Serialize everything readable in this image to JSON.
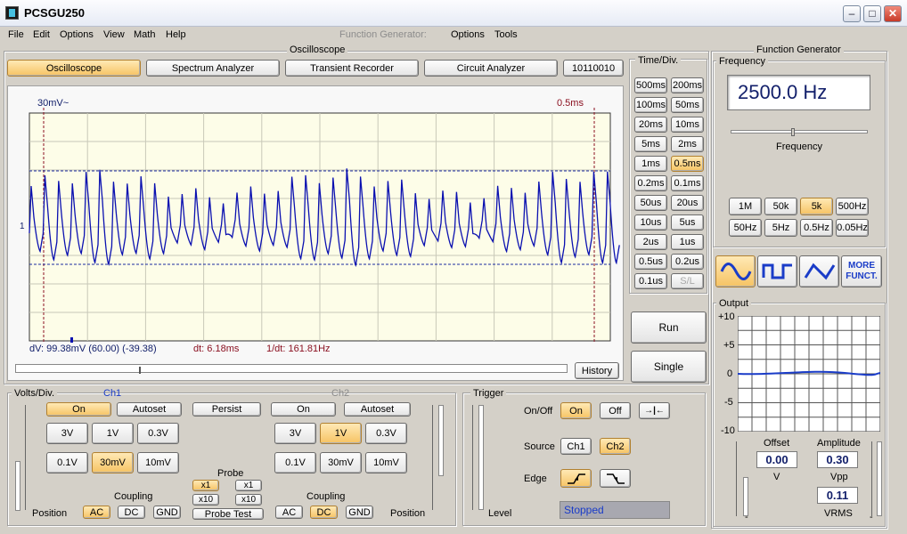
{
  "window": {
    "title": "PCSGU250"
  },
  "menu": {
    "file": "File",
    "edit": "Edit",
    "options": "Options",
    "view": "View",
    "math": "Math",
    "help": "Help",
    "fg_label": "Function Generator:",
    "fg_options": "Options",
    "fg_tools": "Tools"
  },
  "osc": {
    "group_title": "Oscilloscope",
    "tabs": [
      "Oscilloscope",
      "Spectrum Analyzer",
      "Transient Recorder",
      "Circuit Analyzer",
      "10110010"
    ],
    "display": {
      "ch_label": "30mV~",
      "timebase": "0.5ms",
      "marker": "1",
      "dv": "dV: 99.38mV  (60.00) (-39.38)",
      "dt": "dt: 6.18ms",
      "inv_dt": "1/dt: 161.81Hz",
      "history": "History"
    }
  },
  "timediv": {
    "title": "Time/Div.",
    "buttons": [
      "500ms",
      "200ms",
      "100ms",
      "50ms",
      "20ms",
      "10ms",
      "5ms",
      "2ms",
      "1ms",
      "0.5ms",
      "0.2ms",
      "0.1ms",
      "50us",
      "20us",
      "10us",
      "5us",
      "2us",
      "1us",
      "0.5us",
      "0.2us",
      "0.1us",
      "S/L"
    ],
    "selected": "0.5ms"
  },
  "run": {
    "run": "Run",
    "single": "Single"
  },
  "volts": {
    "title": "Volts/Div.",
    "ch1": "Ch1",
    "ch2": "Ch2",
    "on": "On",
    "autoset": "Autoset",
    "persist": "Persist",
    "ranges": [
      "3V",
      "1V",
      "0.3V",
      "0.1V",
      "30mV",
      "10mV"
    ],
    "ch1_sel": "30mV",
    "ch2_sel": "1V",
    "probe": "Probe",
    "x1": "x1",
    "x10": "x10",
    "probe_test": "Probe Test",
    "coupling": "Coupling",
    "ac": "AC",
    "dc": "DC",
    "gnd": "GND",
    "position": "Position"
  },
  "trigger": {
    "title": "Trigger",
    "onoff": "On/Off",
    "on": "On",
    "off": "Off",
    "source": "Source",
    "ch1": "Ch1",
    "ch2": "Ch2",
    "edge": "Edge",
    "level": "Level",
    "status": "Stopped"
  },
  "fgen": {
    "title": "Function Generator",
    "freq_title": "Frequency",
    "freq_value": "2500.0 Hz",
    "freq_label": "Frequency",
    "ranges": [
      "1M",
      "50k",
      "5k",
      "500Hz",
      "50Hz",
      "5Hz",
      "0.5Hz",
      "0.05Hz"
    ],
    "range_sel": "5k",
    "more": "MORE FUNCT.",
    "output_title": "Output",
    "y_ticks": [
      "+10",
      "+5",
      "0",
      "-5",
      "-10"
    ],
    "offset_label": "Offset",
    "offset": "0.00",
    "offset_unit": "V",
    "amp_label": "Amplitude",
    "amp": "0.30",
    "vpp": "Vpp",
    "vrms_val": "0.11",
    "vrms": "VRMS"
  },
  "colors": {
    "trace": "#0a10b0",
    "cursor": "#8a1020",
    "accent": "#f6c363"
  }
}
